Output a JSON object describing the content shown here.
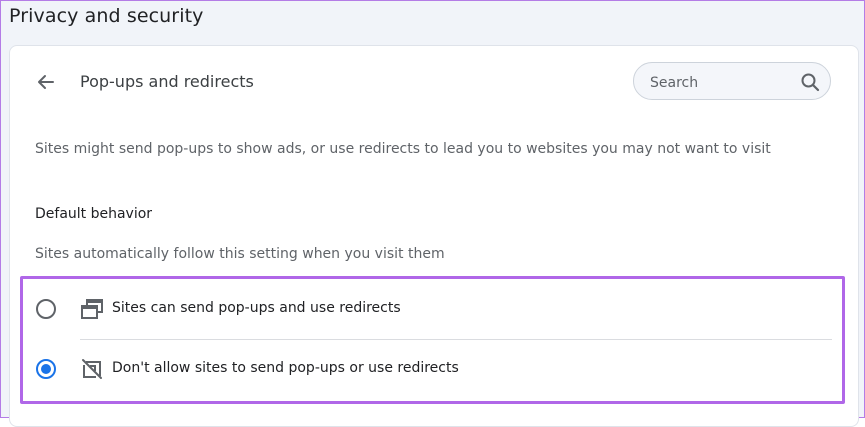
{
  "section_title": "Privacy and security",
  "page": {
    "title": "Pop-ups and redirects",
    "description": "Sites might send pop-ups to show ads, or use redirects to lead you to websites you may not want to visit"
  },
  "search": {
    "placeholder": "Search",
    "value": ""
  },
  "default_behavior": {
    "heading": "Default behavior",
    "description": "Sites automatically follow this setting when you visit them",
    "options": [
      {
        "label": "Sites can send pop-ups and use redirects",
        "icon": "popup-windows-icon",
        "selected": false
      },
      {
        "label": "Don't allow sites to send pop-ups or use redirects",
        "icon": "popup-blocked-icon",
        "selected": true
      }
    ]
  },
  "colors": {
    "accent": "#1a73e8",
    "highlight": "#b067e8"
  }
}
